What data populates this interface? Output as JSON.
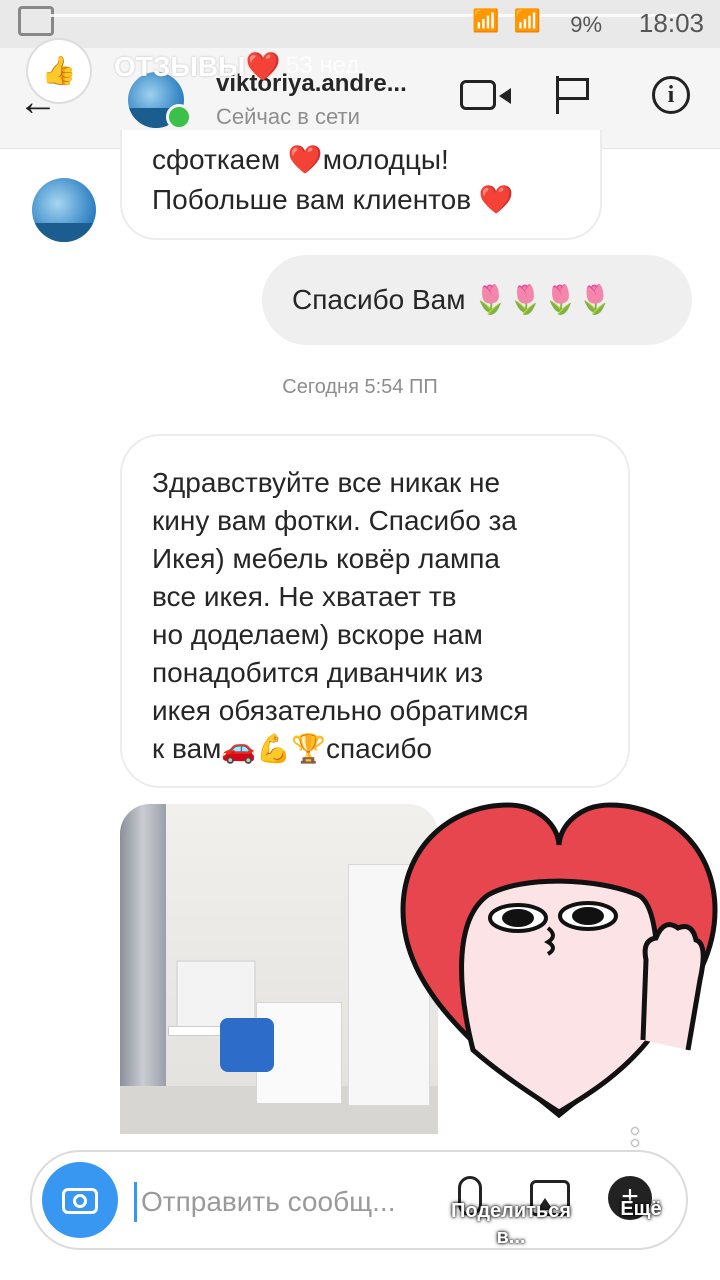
{
  "status_bar": {
    "time": "18:03",
    "battery": "9%"
  },
  "story": {
    "title": "ОТЗЫВЫ❤️",
    "time_ago": "53 нед."
  },
  "header": {
    "username": "viktoriya.andre...",
    "status": "Сейчас в сети",
    "icons": [
      "back-arrow-icon",
      "video-call-icon",
      "flag-icon",
      "info-icon"
    ]
  },
  "chat": {
    "prev_incoming_text": "сфоткаем ❤️молодцы!\nПобольше вам клиентов ❤️",
    "outgoing_text": "Спасибо Вам 🌷🌷🌷🌷",
    "date_separator": "Сегодня 5:54 ПП",
    "incoming_text": "Здравствуйте все никак не\nкину вам фотки. Спасибо за\nИкея) мебель ковёр лампа\nвсе икея. Не хватает тв\nно доделаем) вскоре нам\nпонадобится диванчик из\nикея обязательно обратимся\nк вам🚗💪🏆спасибо"
  },
  "composer": {
    "placeholder": "Отправить сообщ..."
  },
  "story_actions": {
    "share_label": "Поделиться в...",
    "more_label": "Ещё"
  },
  "colors": {
    "accent": "#3897f0",
    "online": "#3bc04a",
    "sticker_heart": "#e8464e"
  }
}
